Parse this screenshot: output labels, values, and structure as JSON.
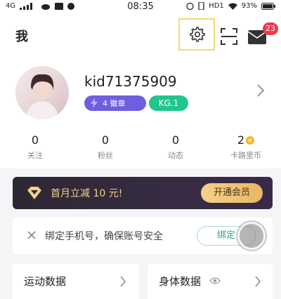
{
  "status_bar": {
    "network": "4G",
    "time": "08:35",
    "hd_label": "HD1",
    "battery": "93%"
  },
  "header": {
    "title": "我",
    "message_badge": "23"
  },
  "profile": {
    "username": "kid71375909",
    "medal_label": "4 徽章",
    "level_label": "KG.1"
  },
  "stats": [
    {
      "value": "0",
      "label": "关注"
    },
    {
      "value": "0",
      "label": "粉丝"
    },
    {
      "value": "0",
      "label": "动态"
    },
    {
      "value": "2",
      "label": "卡路里币"
    }
  ],
  "vip_banner": {
    "text": "首月立减 10 元!",
    "button_label": "开通会员"
  },
  "bind_phone": {
    "text": "绑定手机号，确保账号安全",
    "button_label": "绑定"
  },
  "cards": {
    "sport_label": "运动数据",
    "body_label": "身体数据"
  },
  "colors": {
    "accent_green": "#20c58f",
    "badge_red": "#ef3a4b",
    "medal_purple": "#6e5ee0",
    "vip_gold": "#f5d08a"
  }
}
